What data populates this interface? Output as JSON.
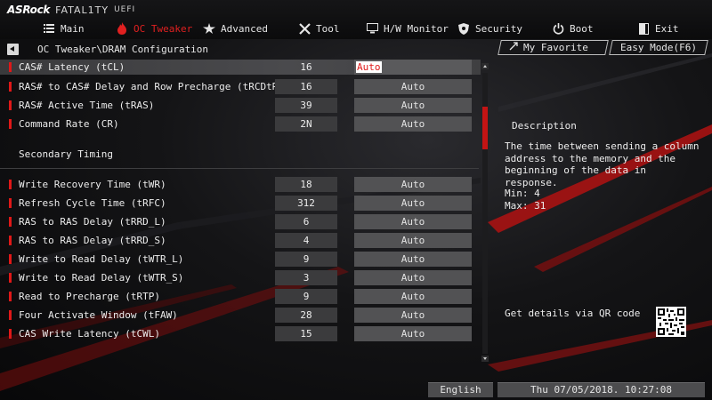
{
  "brand": {
    "maker": "ASRock",
    "series": "FATAL1TY",
    "suffix": "UEFI"
  },
  "nav": [
    {
      "label": "Main",
      "icon": "list-icon",
      "active": false
    },
    {
      "label": "OC Tweaker",
      "icon": "flame-icon",
      "active": true
    },
    {
      "label": "Advanced",
      "icon": "star-icon",
      "active": false
    },
    {
      "label": "Tool",
      "icon": "wrench-icon",
      "active": false
    },
    {
      "label": "H/W Monitor",
      "icon": "monitor-icon",
      "active": false
    },
    {
      "label": "Security",
      "icon": "shield-icon",
      "active": false
    },
    {
      "label": "Boot",
      "icon": "power-icon",
      "active": false
    },
    {
      "label": "Exit",
      "icon": "exit-icon",
      "active": false
    }
  ],
  "breadcrumb": "OC Tweaker\\DRAM Configuration",
  "header_buttons": {
    "favorite": "My Favorite",
    "easy_mode": "Easy Mode(F6)"
  },
  "primary_timings": [
    {
      "label": "CAS# Latency (tCL)",
      "current": "16",
      "setting": "Auto"
    },
    {
      "label": "RAS# to CAS# Delay and Row Precharge (tRCDtRP)",
      "current": "16",
      "setting": "Auto"
    },
    {
      "label": "RAS# Active Time (tRAS)",
      "current": "39",
      "setting": "Auto"
    },
    {
      "label": "Command Rate (CR)",
      "current": "2N",
      "setting": "Auto"
    }
  ],
  "secondary_title": "Secondary Timing",
  "secondary_timings": [
    {
      "label": "Write Recovery Time (tWR)",
      "current": "18",
      "setting": "Auto"
    },
    {
      "label": "Refresh Cycle Time (tRFC)",
      "current": "312",
      "setting": "Auto"
    },
    {
      "label": "RAS to RAS Delay (tRRD_L)",
      "current": "6",
      "setting": "Auto"
    },
    {
      "label": "RAS to RAS Delay (tRRD_S)",
      "current": "4",
      "setting": "Auto"
    },
    {
      "label": "Write to Read Delay (tWTR_L)",
      "current": "9",
      "setting": "Auto"
    },
    {
      "label": "Write to Read Delay (tWTR_S)",
      "current": "3",
      "setting": "Auto"
    },
    {
      "label": "Read to Precharge (tRTP)",
      "current": "9",
      "setting": "Auto"
    },
    {
      "label": "Four Activate Window (tFAW)",
      "current": "28",
      "setting": "Auto"
    },
    {
      "label": "CAS Write Latency (tCWL)",
      "current": "15",
      "setting": "Auto"
    }
  ],
  "description": {
    "title": "Description",
    "body": "The time between sending a column\naddress to the memory and the\nbeginning of the data in response.",
    "min": "Min: 4",
    "max": "Max: 31",
    "qr_label": "Get details via QR code"
  },
  "footer": {
    "language": "English",
    "datetime": "Thu 07/05/2018. 10:27:08"
  },
  "colors": {
    "accent_red": "#e01818",
    "selected_row": "#454548",
    "value_box": "#525254"
  }
}
